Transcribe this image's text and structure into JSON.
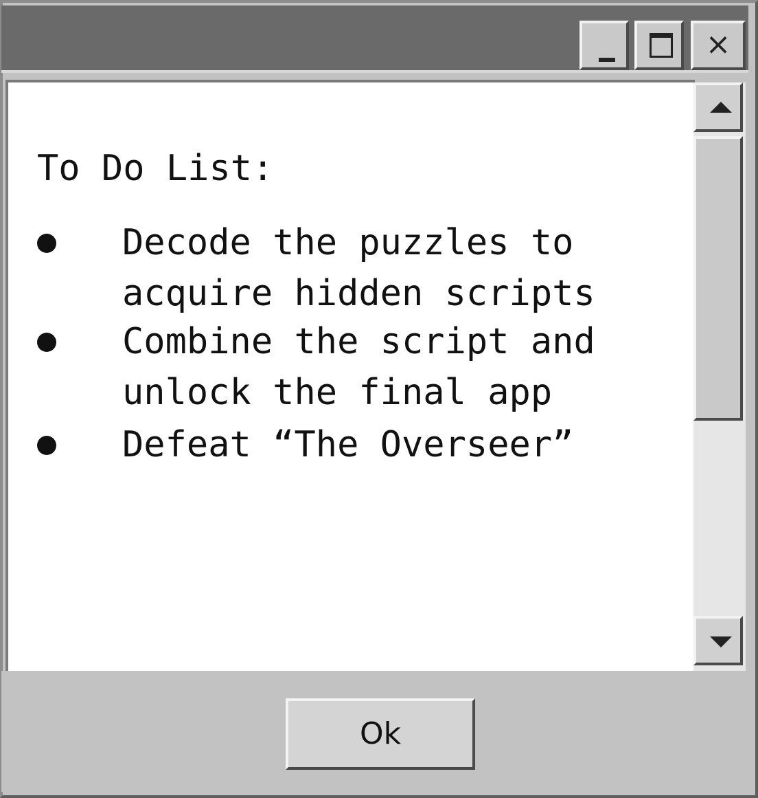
{
  "window": {
    "title": "",
    "controls": {
      "minimize_icon": "minimize-icon",
      "maximize_icon": "maximize-icon",
      "close_icon": "close-icon",
      "close_glyph": "×"
    }
  },
  "content": {
    "heading": "To Do List:",
    "items": [
      {
        "lines": [
          "Decode the puzzles to",
          "acquire hidden scripts"
        ]
      },
      {
        "lines": [
          "Combine the script and",
          "unlock the final app"
        ]
      },
      {
        "lines": [
          "Defeat “The Overseer”"
        ]
      }
    ]
  },
  "scrollbar": {
    "up_icon": "triangle-up-icon",
    "down_icon": "triangle-down-icon",
    "thumb_fraction": 0.5
  },
  "footer": {
    "ok_label": "Ok"
  },
  "colors": {
    "titlebar": "#6a6a6a",
    "chrome": "#c2c2c2",
    "content_bg": "#ffffff",
    "text": "#111111"
  }
}
